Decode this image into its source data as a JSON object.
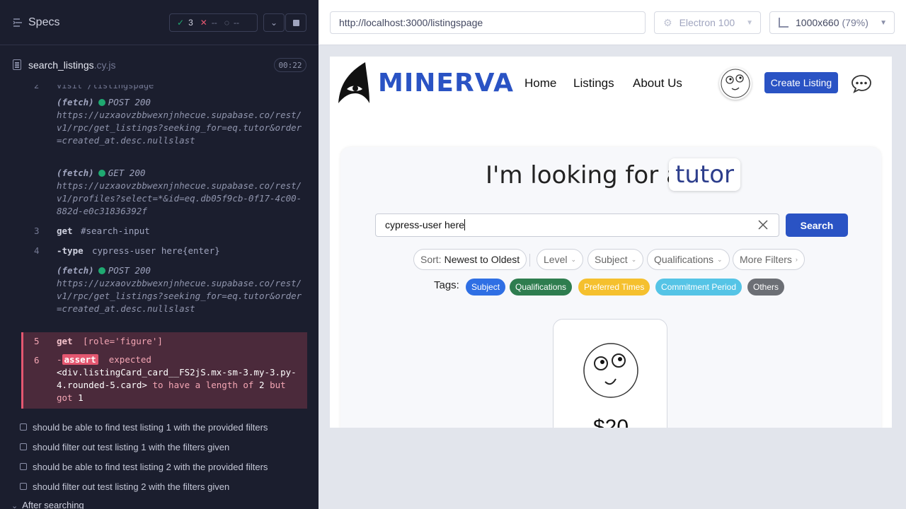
{
  "runner": {
    "specs_label": "Specs",
    "stats": {
      "passed": "3",
      "failed": "--",
      "pending": "--"
    },
    "file": {
      "name": "search_listings",
      "ext": ".cy.js",
      "duration": "00:22"
    },
    "cut_text": "visit  /listingspage",
    "log": [
      {
        "type": "fetch",
        "method": "POST",
        "status": "200",
        "url": "https://uzxaovzbbwexnjnhecue.supabase.co/rest/v1/rpc/get_listings?seeking_for=eq.tutor&order=created_at.desc.nullslast"
      },
      {
        "type": "fetch",
        "method": "GET",
        "status": "200",
        "url": "https://uzxaovzbbwexnjnhecue.supabase.co/rest/v1/profiles?select=*&id=eq.db05f9cb-0f17-4c00-882d-e0c31836392f"
      },
      {
        "type": "cmd",
        "num": "3",
        "name": "get",
        "arg": "#search-input"
      },
      {
        "type": "cmd",
        "num": "4",
        "name": "-type",
        "arg": "cypress-user here{enter}"
      },
      {
        "type": "fetch",
        "method": "POST",
        "status": "200",
        "url": "https://uzxaovzbbwexnjnhecue.supabase.co/rest/v1/rpc/get_listings?seeking_for=eq.tutor&order=created_at.desc.nullslast"
      }
    ],
    "fetch_label": "(fetch)",
    "error": {
      "cmd_num": "5",
      "cmd_name": "get",
      "cmd_arg": "[role='figure']",
      "assert_num": "6",
      "assert_prefix": "-",
      "assert_label": "assert",
      "expected": "expected",
      "selector": "<div.listingCard_card__FS2jS.mx-sm-3.my-3.py-4.rounded-5.card>",
      "mid": "to have a length of",
      "expected_len": "2",
      "but": "but got",
      "got_len": "1"
    },
    "tests": [
      "should be able to find test listing 1 with the provided filters",
      "should filter out test listing 1 with the filters given",
      "should be able to find test listing 2 with the provided filters",
      "should filter out test listing 2 with the filters given"
    ],
    "after_label": "After searching"
  },
  "preview": {
    "url": "http://localhost:3000/listingspage",
    "browser": "Electron 100",
    "viewport": "1000x660",
    "zoom": "(79%)"
  },
  "app": {
    "logo": "MINERVA",
    "nav": [
      "Home",
      "Listings",
      "About Us"
    ],
    "create_button": "Create Listing",
    "hero_lead": "I'm looking for a",
    "hero_pill": "tutor",
    "search_value": "cypress-user here",
    "search_button": "Search",
    "filters": {
      "sort_label": "Sort:",
      "sort_value": "Newest to Oldest",
      "level": "Level",
      "subject": "Subject",
      "qualifications": "Qualifications",
      "more": "More Filters"
    },
    "tags_label": "Tags:",
    "tags": [
      {
        "label": "Subject",
        "color": "#2f6fe4"
      },
      {
        "label": "Qualifications",
        "color": "#2e7d4f"
      },
      {
        "label": "Preferred Times",
        "color": "#f5c02e"
      },
      {
        "label": "Commitment Period",
        "color": "#55c4e6"
      },
      {
        "label": "Others",
        "color": "#6c6f75"
      }
    ],
    "card_price": "$20"
  }
}
